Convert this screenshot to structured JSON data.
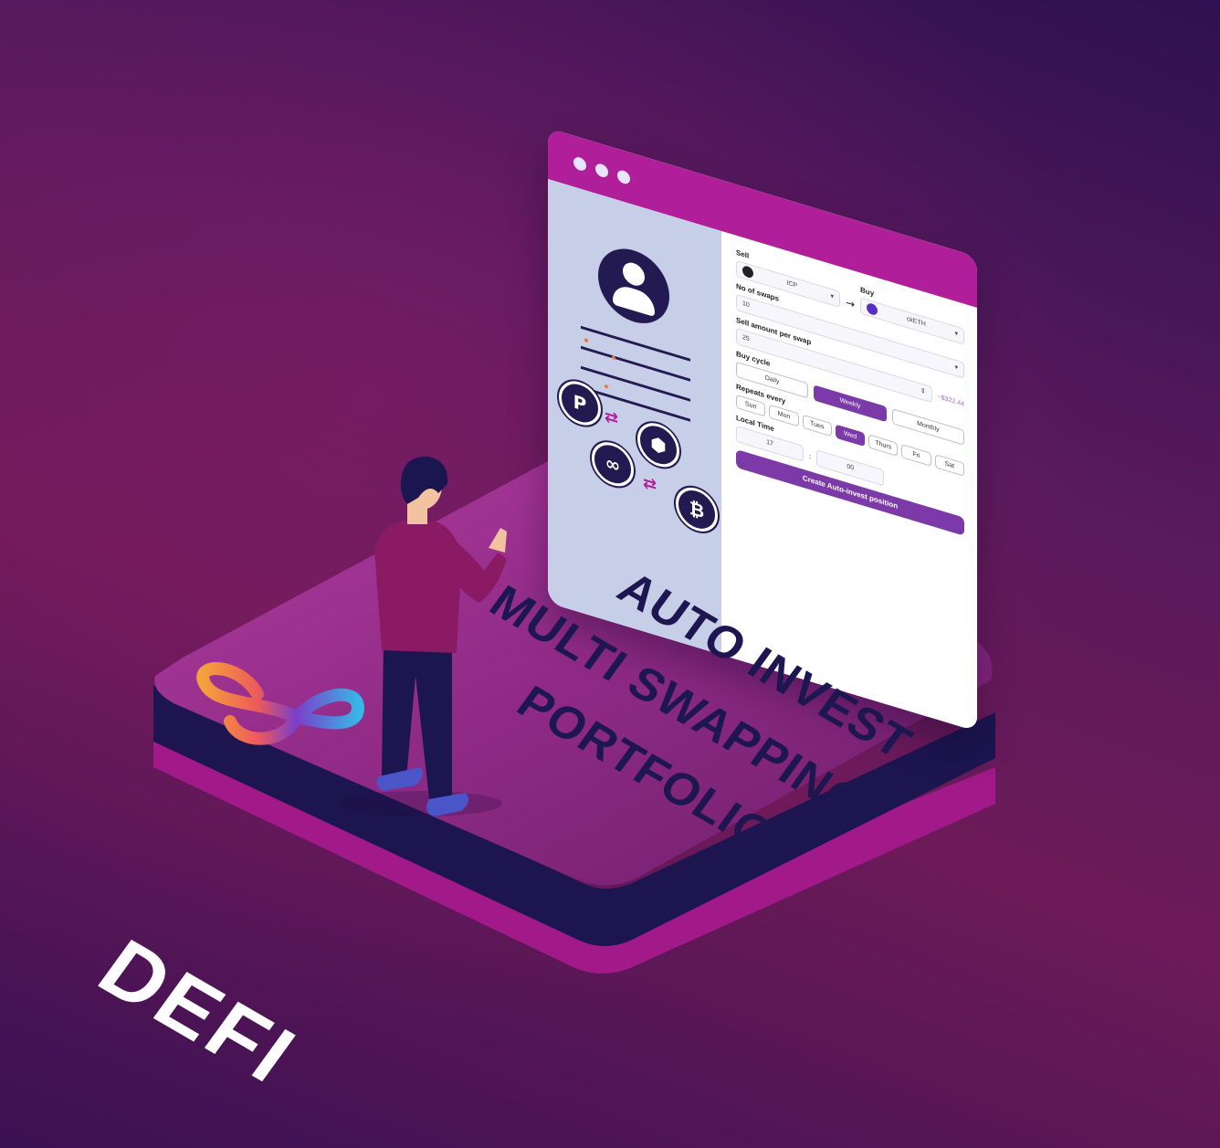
{
  "headline": {
    "line1": "AUTO INVEST",
    "line2": "MULTI SWAPPING",
    "line3": "PORTFOLIO"
  },
  "brand_text": "DEFI",
  "sidebar": {
    "coins": [
      "P",
      "⬢",
      "∞",
      "₿"
    ],
    "coin_icons": [
      "polkadot-icon",
      "bnb-icon",
      "polygon-icon",
      "bitcoin-icon"
    ]
  },
  "form": {
    "sell_label": "Sell",
    "sell_token": "ICP",
    "buy_label": "Buy",
    "buy_token": "ckETH",
    "swaps_label": "No of swaps",
    "swaps_value": "10",
    "amount_label": "Sell amount per swap",
    "amount_value": "25",
    "amount_hint": "~$322.44",
    "cycle_label": "Buy cycle",
    "cycles": [
      "Daily",
      "Weekly",
      "Monthly"
    ],
    "cycle_selected": "Weekly",
    "repeats_label": "Repeats every",
    "days": [
      "Sun",
      "Mon",
      "Tues",
      "Wed",
      "Thurs",
      "Fri",
      "Sat"
    ],
    "day_selected": "Wed",
    "time_label": "Local Time",
    "time_hour": "17",
    "time_sep": ":",
    "time_min": "00",
    "cta": "Create Auto-invest position"
  },
  "colors": {
    "accent": "#b01e9a",
    "button": "#7b3aa8",
    "navy": "#1d1650"
  }
}
